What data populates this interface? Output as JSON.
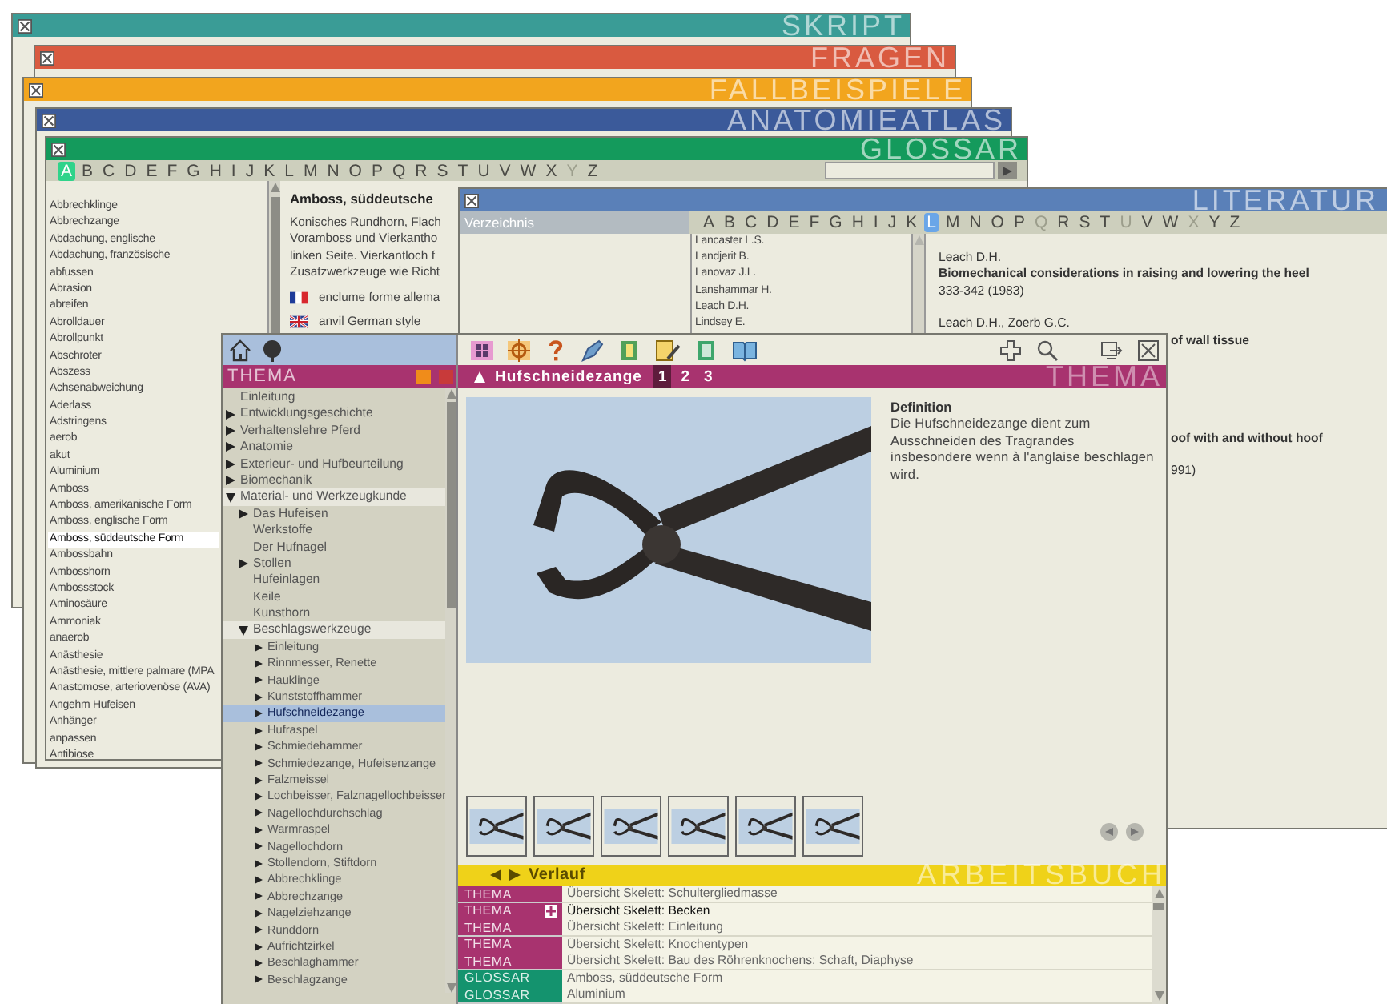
{
  "background_windows": [
    {
      "title": "SKRIPT",
      "color": "#3a9c96"
    },
    {
      "title": "FRAGEN",
      "color": "#d95a40"
    },
    {
      "title": "FALLBEISPIELE",
      "color": "#f2a51e"
    },
    {
      "title": "ANATOMIEATLAS",
      "color": "#3b5a9a"
    }
  ],
  "glossar": {
    "title": "GLOSSAR",
    "color": "#149a5c",
    "letters": [
      {
        "label": "A",
        "selected": true,
        "disabled": false
      },
      {
        "label": "B",
        "selected": false,
        "disabled": false
      },
      {
        "label": "C",
        "selected": false,
        "disabled": false
      },
      {
        "label": "D",
        "selected": false,
        "disabled": false
      },
      {
        "label": "E",
        "selected": false,
        "disabled": false
      },
      {
        "label": "F",
        "selected": false,
        "disabled": false
      },
      {
        "label": "G",
        "selected": false,
        "disabled": false
      },
      {
        "label": "H",
        "selected": false,
        "disabled": false
      },
      {
        "label": "I",
        "selected": false,
        "disabled": false
      },
      {
        "label": "J",
        "selected": false,
        "disabled": false
      },
      {
        "label": "K",
        "selected": false,
        "disabled": false
      },
      {
        "label": "L",
        "selected": false,
        "disabled": false
      },
      {
        "label": "M",
        "selected": false,
        "disabled": false
      },
      {
        "label": "N",
        "selected": false,
        "disabled": false
      },
      {
        "label": "O",
        "selected": false,
        "disabled": false
      },
      {
        "label": "P",
        "selected": false,
        "disabled": false
      },
      {
        "label": "Q",
        "selected": false,
        "disabled": false
      },
      {
        "label": "R",
        "selected": false,
        "disabled": false
      },
      {
        "label": "S",
        "selected": false,
        "disabled": false
      },
      {
        "label": "T",
        "selected": false,
        "disabled": false
      },
      {
        "label": "U",
        "selected": false,
        "disabled": false
      },
      {
        "label": "V",
        "selected": false,
        "disabled": false
      },
      {
        "label": "W",
        "selected": false,
        "disabled": false
      },
      {
        "label": "X",
        "selected": false,
        "disabled": false
      },
      {
        "label": "Y",
        "selected": false,
        "disabled": true
      },
      {
        "label": "Z",
        "selected": false,
        "disabled": false
      }
    ],
    "entries": [
      {
        "label": "Abbrechklinge",
        "selected": false
      },
      {
        "label": "Abbrechzange",
        "selected": false
      },
      {
        "label": "Abdachung, englische",
        "selected": false
      },
      {
        "label": "Abdachung, französische",
        "selected": false
      },
      {
        "label": "abfussen",
        "selected": false
      },
      {
        "label": "Abrasion",
        "selected": false
      },
      {
        "label": "abreifen",
        "selected": false
      },
      {
        "label": "Abrolldauer",
        "selected": false
      },
      {
        "label": "Abrollpunkt",
        "selected": false
      },
      {
        "label": "Abschroter",
        "selected": false
      },
      {
        "label": "Abszess",
        "selected": false
      },
      {
        "label": "Achsenabweichung",
        "selected": false
      },
      {
        "label": "Aderlass",
        "selected": false
      },
      {
        "label": "Adstringens",
        "selected": false
      },
      {
        "label": "aerob",
        "selected": false
      },
      {
        "label": "akut",
        "selected": false
      },
      {
        "label": "Aluminium",
        "selected": false
      },
      {
        "label": "Amboss",
        "selected": false
      },
      {
        "label": "Amboss, amerikanische Form",
        "selected": false
      },
      {
        "label": "Amboss, englische Form",
        "selected": false
      },
      {
        "label": "Amboss, süddeutsche Form",
        "selected": true
      },
      {
        "label": "Ambossbahn",
        "selected": false
      },
      {
        "label": "Ambosshorn",
        "selected": false
      },
      {
        "label": "Ambossstock",
        "selected": false
      },
      {
        "label": "Aminosäure",
        "selected": false
      },
      {
        "label": "Ammoniak",
        "selected": false
      },
      {
        "label": "anaerob",
        "selected": false
      },
      {
        "label": "Anästhesie",
        "selected": false
      },
      {
        "label": "Anästhesie, mittlere palmare (MPA",
        "selected": false
      },
      {
        "label": "Anastomose, arteriovenöse (AVA)",
        "selected": false
      },
      {
        "label": "Angehm Hufeisen",
        "selected": false
      },
      {
        "label": "Anhänger",
        "selected": false
      },
      {
        "label": "anpassen",
        "selected": false
      },
      {
        "label": "Antibiose",
        "selected": false
      }
    ],
    "detail": {
      "heading": "Amboss, süddeutsche",
      "lines": [
        "Konisches Rundhorn, Flach",
        "Voramboss und Vierkantho",
        "linken Seite. Vierkantloch f",
        "Zusatzwerkzeuge wie Richt"
      ],
      "translations": [
        {
          "kind": "fr",
          "text": "enclume forme allema"
        },
        {
          "kind": "gb",
          "text": "anvil German style"
        }
      ]
    }
  },
  "literatur": {
    "title": "LITERATUR",
    "color": "#5a80b8",
    "index_label": "Verzeichnis",
    "letters": [
      {
        "label": "A",
        "selected": false,
        "disabled": false
      },
      {
        "label": "B",
        "selected": false,
        "disabled": false
      },
      {
        "label": "C",
        "selected": false,
        "disabled": false
      },
      {
        "label": "D",
        "selected": false,
        "disabled": false
      },
      {
        "label": "E",
        "selected": false,
        "disabled": false
      },
      {
        "label": "F",
        "selected": false,
        "disabled": false
      },
      {
        "label": "G",
        "selected": false,
        "disabled": false
      },
      {
        "label": "H",
        "selected": false,
        "disabled": false
      },
      {
        "label": "I",
        "selected": false,
        "disabled": false
      },
      {
        "label": "J",
        "selected": false,
        "disabled": false
      },
      {
        "label": "K",
        "selected": false,
        "disabled": false
      },
      {
        "label": "L",
        "selected": true,
        "disabled": false
      },
      {
        "label": "M",
        "selected": false,
        "disabled": false
      },
      {
        "label": "N",
        "selected": false,
        "disabled": false
      },
      {
        "label": "O",
        "selected": false,
        "disabled": false
      },
      {
        "label": "P",
        "selected": false,
        "disabled": false
      },
      {
        "label": "Q",
        "selected": false,
        "disabled": true
      },
      {
        "label": "R",
        "selected": false,
        "disabled": false
      },
      {
        "label": "S",
        "selected": false,
        "disabled": false
      },
      {
        "label": "T",
        "selected": false,
        "disabled": false
      },
      {
        "label": "U",
        "selected": false,
        "disabled": true
      },
      {
        "label": "V",
        "selected": false,
        "disabled": false
      },
      {
        "label": "W",
        "selected": false,
        "disabled": false
      },
      {
        "label": "X",
        "selected": false,
        "disabled": true
      },
      {
        "label": "Y",
        "selected": false,
        "disabled": false
      },
      {
        "label": "Z",
        "selected": false,
        "disabled": false
      }
    ],
    "authors": [
      "Lancaster L.S.",
      "Landjerit B.",
      "Lanovaz J.L.",
      "Lanshammar H.",
      "Leach D.H.",
      "Lindsey E."
    ],
    "references": [
      {
        "authors": "Leach D.H.",
        "title": "Biomechanical considerations in raising and lowering the heel",
        "source": "333-342 (1983)"
      },
      {
        "authors": "Leach D.H., Zoerb G.C."
      }
    ],
    "cut_lines": [
      {
        "text": "of wall tissue",
        "bold": true
      },
      {
        "text": "oof with and without hoof",
        "bold": true
      },
      {
        "text": "991)",
        "bold": false
      }
    ]
  },
  "thema": {
    "panel_title": "THEMA",
    "title": "THEMA",
    "topic": "Hufschneidezange",
    "pages": [
      {
        "label": "1",
        "selected": true
      },
      {
        "label": "2",
        "selected": false
      },
      {
        "label": "3",
        "selected": false
      }
    ],
    "tree": [
      {
        "label": "Einleitung",
        "kind": "page",
        "selected": false
      },
      {
        "label": "Entwicklungsgeschichte",
        "kind": "folder",
        "expanded": false,
        "selected": false
      },
      {
        "label": "Verhaltenslehre Pferd",
        "kind": "folder",
        "expanded": false,
        "selected": false
      },
      {
        "label": "Anatomie",
        "kind": "folder",
        "expanded": false,
        "selected": false
      },
      {
        "label": "Exterieur- und Hufbeurteilung",
        "kind": "folder",
        "expanded": false,
        "selected": false
      },
      {
        "label": "Biomechanik",
        "kind": "folder",
        "expanded": false,
        "selected": false
      },
      {
        "label": "Material- und Werkzeugkunde",
        "kind": "folder",
        "expanded": true,
        "selected": false,
        "children": [
          {
            "label": "Das Hufeisen",
            "kind": "folder",
            "expanded": false,
            "selected": false
          },
          {
            "label": "Werkstoffe",
            "kind": "page",
            "selected": false
          },
          {
            "label": "Der Hufnagel",
            "kind": "page",
            "selected": false
          },
          {
            "label": "Stollen",
            "kind": "folder",
            "expanded": false,
            "selected": false
          },
          {
            "label": "Hufeinlagen",
            "kind": "page",
            "selected": false
          },
          {
            "label": "Keile",
            "kind": "page",
            "selected": false
          },
          {
            "label": "Kunsthorn",
            "kind": "page",
            "selected": false
          },
          {
            "label": "Beschlagswerkzeuge",
            "kind": "folder",
            "expanded": true,
            "selected": false,
            "children": [
              {
                "label": "Einleitung",
                "kind": "folder",
                "expanded": false,
                "selected": false
              },
              {
                "label": "Rinnmesser, Renette",
                "kind": "folder",
                "expanded": false,
                "selected": false
              },
              {
                "label": "Hauklinge",
                "kind": "folder",
                "expanded": false,
                "selected": false
              },
              {
                "label": "Kunststoffhammer",
                "kind": "folder",
                "expanded": false,
                "selected": false
              },
              {
                "label": "Hufschneidezange",
                "kind": "folder",
                "expanded": false,
                "selected": true
              },
              {
                "label": "Hufraspel",
                "kind": "folder",
                "expanded": false,
                "selected": false
              },
              {
                "label": "Schmiedehammer",
                "kind": "folder",
                "expanded": false,
                "selected": false
              },
              {
                "label": "Schmiedezange, Hufeisenzange",
                "kind": "folder",
                "expanded": false,
                "selected": false
              },
              {
                "label": "Falzmeissel",
                "kind": "folder",
                "expanded": false,
                "selected": false
              },
              {
                "label": "Lochbeisser, Falznagellochbeisser",
                "kind": "folder",
                "expanded": false,
                "selected": false
              },
              {
                "label": "Nagellochdurchschlag",
                "kind": "folder",
                "expanded": false,
                "selected": false
              },
              {
                "label": "Warmraspel",
                "kind": "folder",
                "expanded": false,
                "selected": false
              },
              {
                "label": "Nagellochdorn",
                "kind": "folder",
                "expanded": false,
                "selected": false
              },
              {
                "label": "Stollendorn, Stiftdorn",
                "kind": "folder",
                "expanded": false,
                "selected": false
              },
              {
                "label": "Abbrechklinge",
                "kind": "folder",
                "expanded": false,
                "selected": false
              },
              {
                "label": "Abbrechzange",
                "kind": "folder",
                "expanded": false,
                "selected": false
              },
              {
                "label": "Nagelziehzange",
                "kind": "folder",
                "expanded": false,
                "selected": false
              },
              {
                "label": "Runddorn",
                "kind": "folder",
                "expanded": false,
                "selected": false
              },
              {
                "label": "Aufrichtzirkel",
                "kind": "folder",
                "expanded": false,
                "selected": false
              },
              {
                "label": "Beschlaghammer",
                "kind": "folder",
                "expanded": false,
                "selected": false
              },
              {
                "label": "Beschlagzange",
                "kind": "folder",
                "expanded": false,
                "selected": false
              }
            ]
          }
        ]
      }
    ],
    "definition": {
      "heading": "Definition",
      "text": "Die Hufschneidezange dient zum Ausschneiden des Tragrandes insbesondere wenn à l'anglaise beschlagen wird."
    }
  },
  "arbeitsbuch": {
    "title": "ARBEITSBUCH",
    "history_label": "Verlauf",
    "rows": [
      {
        "source": "THEMA",
        "color": "#a8336f",
        "text": "Übersicht Skelett: Schultergliedmasse",
        "selected": false
      },
      {
        "source": "THEMA",
        "color": "#a8336f",
        "text": "Übersicht Skelett: Becken",
        "selected": true
      },
      {
        "source": "THEMA",
        "color": "#a8336f",
        "text": "Übersicht Skelett: Einleitung",
        "selected": false
      },
      {
        "source": "THEMA",
        "color": "#a8336f",
        "text": "Übersicht Skelett: Knochentypen",
        "selected": false
      },
      {
        "source": "THEMA",
        "color": "#a8336f",
        "text": "Übersicht Skelett: Bau des Röhrenknochens: Schaft, Diaphyse",
        "selected": false
      },
      {
        "source": "GLOSSAR",
        "color": "#14936e",
        "text": "Amboss, süddeutsche Form",
        "selected": false
      },
      {
        "source": "GLOSSAR",
        "color": "#14936e",
        "text": "Aluminium",
        "selected": false
      }
    ]
  }
}
